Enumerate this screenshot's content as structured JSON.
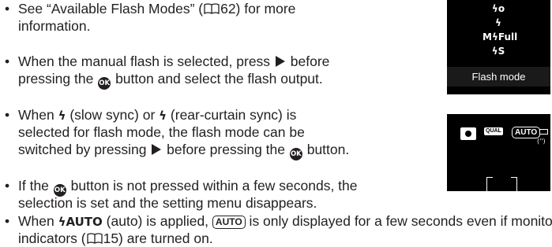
{
  "bullets": [
    {
      "lines": [
        [
          "See “Available Flash Modes” (",
          {
            "icon": "book-icon"
          },
          "62) for more"
        ],
        [
          "information."
        ]
      ]
    },
    {
      "lines": [
        [
          "When the manual flash is selected, press ",
          {
            "icon": "right-triangle-icon"
          },
          " before"
        ],
        [
          "pressing the ",
          {
            "icon": "ok-button-icon"
          },
          " button and select the flash output."
        ]
      ]
    },
    {
      "lines": [
        [
          "When ",
          {
            "icon": "slow-sync-flash-icon"
          },
          " (slow sync) or ",
          {
            "icon": "rear-curtain-flash-icon"
          },
          " (rear-curtain sync) is"
        ],
        [
          "selected for flash mode, the flash mode can be"
        ],
        [
          "switched by pressing ",
          {
            "icon": "right-triangle-icon"
          },
          " before pressing the ",
          {
            "icon": "ok-button-icon"
          },
          " button."
        ]
      ]
    },
    {
      "lines": [
        [
          "If the ",
          {
            "icon": "ok-button-icon"
          },
          " button is not pressed within a few seconds, the"
        ],
        [
          "selection is set and the setting menu disappears."
        ]
      ]
    },
    {
      "lines": [
        [
          "When ",
          {
            "icon": "auto-flash-icon"
          },
          " (auto) is applied, ",
          {
            "icon": "auto-flash-boxed-icon"
          },
          " is only displayed for a few seconds even if monitor"
        ],
        [
          "indicators (",
          {
            "icon": "book-icon"
          },
          "15) are turned on."
        ]
      ]
    }
  ],
  "bullet_char": "•",
  "icons": {
    "ok_label": "OK",
    "auto_label": "AUTO",
    "auto_boxed_label": "AUTO",
    "flash_bolt": "ϟ"
  },
  "screen_flash_menu": {
    "icons": [
      "ϟo",
      "ϟ",
      "MϟFull",
      "ϟS"
    ],
    "label": "Flash mode"
  },
  "screen_shooting": {
    "qual_label": "QUAL",
    "flash_label": "AUTO",
    "shake_label": "('')"
  }
}
